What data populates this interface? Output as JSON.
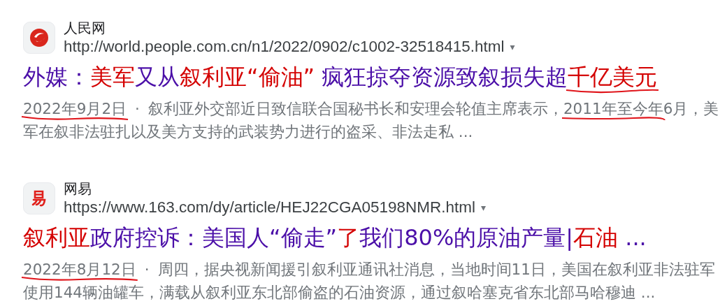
{
  "results": [
    {
      "source": "人民网",
      "url": "http://world.people.com.cn/n1/2022/0902/c1002-32518415.html",
      "url_menu": "▾",
      "title_parts": [
        {
          "text": "外媒：",
          "highlight": false,
          "underlined": false
        },
        {
          "text": "美军",
          "highlight": true,
          "underlined": false
        },
        {
          "text": "又从",
          "highlight": false,
          "underlined": false
        },
        {
          "text": "叙利亚“偷油”",
          "highlight": true,
          "underlined": false
        },
        {
          "text": " 疯狂掠夺资源致叙损失超",
          "highlight": false,
          "underlined": false
        },
        {
          "text": "千亿美元",
          "highlight": true,
          "underlined": true
        }
      ],
      "date": "2022年9月2日",
      "date_underlined": true,
      "separator": "·",
      "snippet_parts": [
        {
          "text": "叙利亚外交部近日致信联合国秘书长和安理会轮值主席表示，",
          "underlined": false
        },
        {
          "text": "2011年至今年",
          "underlined": true
        },
        {
          "text": "6月，美军在叙非法驻扎以及美方支持的武装势力进行的盗采、非法走私 ...",
          "underlined": false
        }
      ]
    },
    {
      "source": "网易",
      "url": "https://www.163.com/dy/article/HEJ22CGA05198NMR.html",
      "url_menu": "▾",
      "title_parts": [
        {
          "text": "叙利亚",
          "highlight": true,
          "underlined": false
        },
        {
          "text": "政府控诉：美国人“偷走”",
          "highlight": false,
          "underlined": false
        },
        {
          "text": "了",
          "highlight": true,
          "underlined": false
        },
        {
          "text": "我们80%的原油产量|",
          "highlight": false,
          "underlined": false
        },
        {
          "text": "石油",
          "highlight": true,
          "underlined": false
        },
        {
          "text": " ...",
          "highlight": false,
          "underlined": false
        }
      ],
      "date": "2022年8月12日",
      "date_underlined": true,
      "separator": "·",
      "snippet_parts": [
        {
          "text": "周四，据央视新闻援引叙利亚通讯社消息，当地时间11日，美国在叙利亚非法驻军使用144辆油罐车，满载从叙利亚东北部偷盗的石油资源，通过叙哈塞克省东北部马哈穆迪 ...",
          "underlined": false
        }
      ]
    }
  ]
}
